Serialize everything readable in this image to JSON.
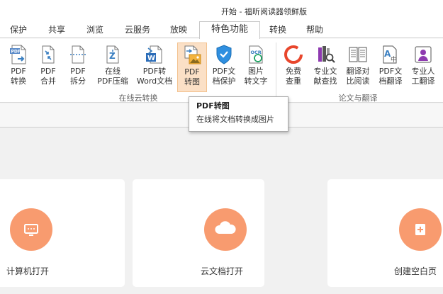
{
  "window": {
    "title": "开始 - 福昕阅读器领鲜版"
  },
  "tabs": [
    {
      "label": "保护"
    },
    {
      "label": "共享"
    },
    {
      "label": "浏览"
    },
    {
      "label": "云服务"
    },
    {
      "label": "放映"
    },
    {
      "label": "特色功能",
      "active": true
    },
    {
      "label": "转换"
    },
    {
      "label": "帮助"
    }
  ],
  "ribbon": {
    "buttons": [
      {
        "line1": "PDF",
        "line2": "转换",
        "icon": "pdf-convert-icon"
      },
      {
        "line1": "PDF",
        "line2": "合并",
        "icon": "pdf-merge-icon"
      },
      {
        "line1": "PDF",
        "line2": "拆分",
        "icon": "pdf-split-icon"
      },
      {
        "line1": "在线",
        "line2": "PDF压缩",
        "icon": "pdf-compress-icon"
      },
      {
        "line1": "PDF转",
        "line2": "Word文档",
        "icon": "pdf-to-word-icon"
      },
      {
        "line1": "PDF",
        "line2": "转图",
        "icon": "pdf-to-image-icon",
        "highlighted": true
      },
      {
        "line1": "PDF文",
        "line2": "档保护",
        "icon": "shield-icon"
      },
      {
        "line1": "图片",
        "line2": "转文字",
        "icon": "ocr-icon"
      },
      {
        "line1": "免费",
        "line2": "查重",
        "icon": "plagiarism-check-icon"
      },
      {
        "line1": "专业文",
        "line2": "献查找",
        "icon": "literature-search-icon"
      },
      {
        "line1": "翻译对",
        "line2": "比阅读",
        "icon": "translate-compare-icon"
      },
      {
        "line1": "PDF文",
        "line2": "档翻译",
        "icon": "document-translate-icon"
      },
      {
        "line1": "专业人",
        "line2": "工翻译",
        "icon": "human-translate-icon"
      }
    ],
    "groups": [
      {
        "label": "在线云转换"
      },
      {
        "label": "论文与翻译"
      }
    ]
  },
  "tooltip": {
    "title": "PDF转图",
    "description": "在线将文档转换成图片"
  },
  "cards": [
    {
      "label": "计算机打开",
      "icon": "computer-icon"
    },
    {
      "label": "云文档打开",
      "icon": "cloud-icon"
    },
    {
      "label": "创建空白页",
      "icon": "add-page-icon"
    }
  ],
  "colors": {
    "accent_orange": "#f89b6f",
    "highlight": "#fbe0c6",
    "blue": "#3a7fc1",
    "red": "#e8462c"
  }
}
